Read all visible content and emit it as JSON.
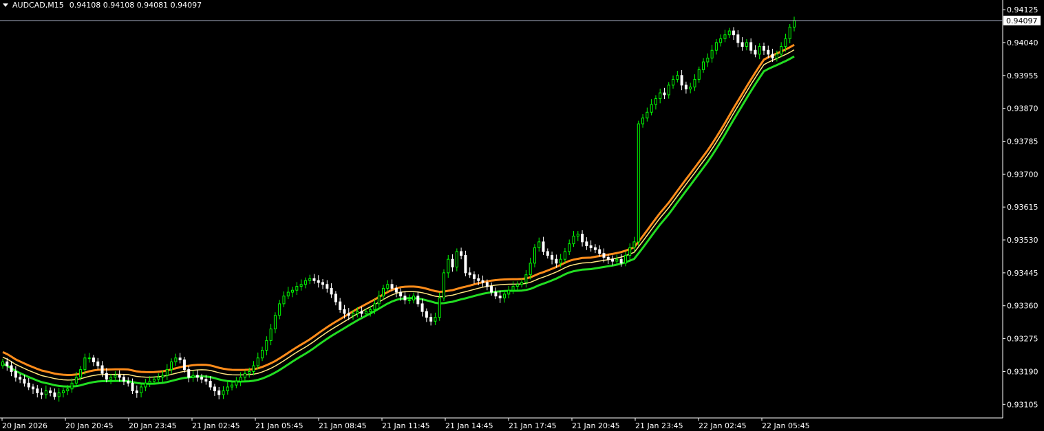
{
  "header": {
    "symbol": "AUDCAD,M15",
    "ohlc": "0.94108 0.94108 0.94081 0.94097"
  },
  "colors": {
    "background": "#000000",
    "axis": "#ffffff",
    "bull_candle": "#00ff00",
    "bear_candle": "#ffffff",
    "upper_band": "#ff8c1a",
    "middle_band": "#ffe680",
    "lower_band": "#22dd22",
    "price_line": "#9aa0b4"
  },
  "chart_data": {
    "type": "candlestick",
    "symbol": "AUDCAD",
    "timeframe": "M15",
    "ylim": [
      0.9307,
      0.9415
    ],
    "yticks": [
      "0.94125",
      "0.94040",
      "0.93955",
      "0.93870",
      "0.93785",
      "0.93700",
      "0.93615",
      "0.93530",
      "0.93445",
      "0.93360",
      "0.93275",
      "0.93190",
      "0.93105"
    ],
    "xticks": [
      "20 Jan 2026",
      "20 Jan 20:45",
      "20 Jan 23:45",
      "21 Jan 02:45",
      "21 Jan 05:45",
      "21 Jan 08:45",
      "21 Jan 11:45",
      "21 Jan 14:45",
      "21 Jan 17:45",
      "21 Jan 20:45",
      "21 Jan 23:45",
      "22 Jan 02:45",
      "22 Jan 05:45"
    ],
    "current_price": "0.94097",
    "closes": [
      0.93215,
      0.93205,
      0.9319,
      0.93175,
      0.9317,
      0.9316,
      0.9315,
      0.93145,
      0.93135,
      0.9313,
      0.9314,
      0.93135,
      0.93125,
      0.93135,
      0.9314,
      0.93145,
      0.9316,
      0.93175,
      0.93195,
      0.93225,
      0.93225,
      0.93215,
      0.93205,
      0.93185,
      0.9317,
      0.93175,
      0.9318,
      0.93175,
      0.93165,
      0.9316,
      0.9314,
      0.93135,
      0.9315,
      0.9316,
      0.93165,
      0.9317,
      0.93175,
      0.9318,
      0.93195,
      0.93215,
      0.93225,
      0.9322,
      0.93195,
      0.93175,
      0.9318,
      0.93175,
      0.9317,
      0.93165,
      0.9315,
      0.9314,
      0.9313,
      0.9314,
      0.9315,
      0.93155,
      0.93165,
      0.93175,
      0.93185,
      0.9319,
      0.93205,
      0.93225,
      0.93245,
      0.9327,
      0.933,
      0.93335,
      0.93365,
      0.93385,
      0.93395,
      0.934,
      0.9341,
      0.93415,
      0.93425,
      0.9343,
      0.93425,
      0.9342,
      0.93415,
      0.93405,
      0.9339,
      0.9337,
      0.9335,
      0.9334,
      0.93335,
      0.9334,
      0.93345,
      0.9334,
      0.93345,
      0.9335,
      0.93365,
      0.93385,
      0.93405,
      0.93415,
      0.93405,
      0.93395,
      0.93385,
      0.93375,
      0.93375,
      0.93385,
      0.93365,
      0.93345,
      0.9333,
      0.9332,
      0.9333,
      0.9338,
      0.93445,
      0.9348,
      0.9346,
      0.935,
      0.9349,
      0.93445,
      0.9344,
      0.9343,
      0.93425,
      0.9342,
      0.9341,
      0.93395,
      0.93385,
      0.9338,
      0.9339,
      0.934,
      0.9341,
      0.93415,
      0.9342,
      0.9344,
      0.9347,
      0.9351,
      0.93525,
      0.935,
      0.9349,
      0.9348,
      0.9347,
      0.9348,
      0.935,
      0.9352,
      0.9354,
      0.93545,
      0.93525,
      0.93515,
      0.9351,
      0.93505,
      0.93495,
      0.93485,
      0.9348,
      0.93475,
      0.9348,
      0.9347,
      0.9349,
      0.9351,
      0.93525,
      0.9383,
      0.93845,
      0.9386,
      0.9388,
      0.93895,
      0.9391,
      0.93905,
      0.9393,
      0.93945,
      0.93955,
      0.9393,
      0.9392,
      0.93925,
      0.93945,
      0.9397,
      0.9399,
      0.94,
      0.9402,
      0.9404,
      0.9405,
      0.9406,
      0.9407,
      0.9406,
      0.9404,
      0.9403,
      0.9404,
      0.9402,
      0.9401,
      0.9403,
      0.9402,
      0.9401,
      0.94,
      0.9401,
      0.9403,
      0.9405,
      0.9408,
      0.94097
    ]
  }
}
